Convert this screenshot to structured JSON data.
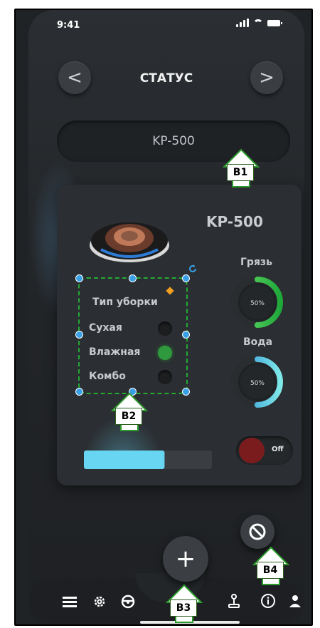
{
  "status": {
    "time": "9:41"
  },
  "header": {
    "title": "СТАТУС",
    "prev": "<",
    "next": ">"
  },
  "device": {
    "name_bar": "KP-500",
    "model": "KP-500"
  },
  "cleaning": {
    "title": "Тип уборки",
    "options": [
      {
        "label": "Сухая",
        "selected": false
      },
      {
        "label": "Влажная",
        "selected": true
      },
      {
        "label": "Комбо",
        "selected": false
      }
    ]
  },
  "gauges": [
    {
      "label": "Грязь",
      "value_text": "50%",
      "fraction": 0.5,
      "color_start": "#1fa83a",
      "color_end": "#6be06b"
    },
    {
      "label": "Вода",
      "value_text": "50%",
      "fraction": 0.5,
      "color_start": "#2a8fd6",
      "color_end": "#7ee7e8"
    }
  ],
  "power": {
    "label": "Off",
    "knob_color": "#7a1c1e"
  },
  "slider": {
    "fraction": 0.63,
    "color": "#68d6f2"
  },
  "callouts": {
    "b1": "B1",
    "b2": "B2",
    "b3": "B3",
    "b4": "B4"
  },
  "bottom_icons": [
    "menu-icon",
    "gear-icon",
    "steering-wheel-icon",
    "joystick-icon",
    "info-icon",
    "user-icon"
  ]
}
